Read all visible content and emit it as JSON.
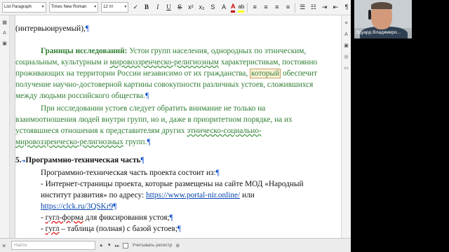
{
  "toolbar": {
    "style_value": "List Paragraph",
    "font_value": "Times New Roman",
    "size_value": "12 пт",
    "bold_icon": "B",
    "italic_icon": "I",
    "underline_icon": "U",
    "font_color_icon": "A",
    "highlight_icon": "ab"
  },
  "document": {
    "line1": "(интервьюируемый),",
    "line2_head": "Границы исследований:",
    "line2_rest": " Устои групп населения, однородных по этническим,",
    "line3_a": "социальным, культурным и ",
    "line3_sq": "мировоззренческо-религиозным",
    "line3_b": " характеристикам, постоянно",
    "line4_a": "проживающих на территории России независимо от их гражданства, ",
    "line4_box": "который",
    "line4_b": " обеспечит",
    "line5": "получение научно-достоверной картины совокупности различных устоев, сложившихся",
    "line6": "между людьми российского общества.",
    "line7": "При исследовании устоев следует обратить внимание не только на",
    "line8": "взаимоотношения людей внутри групп, но и, даже в приоритетном порядке, на их",
    "line9_a": "устоявшиеся отношения к представителям других ",
    "line9_sq": "этническо-социально-",
    "line10_sq": "мировоззренческо-религиозных",
    "line10_b": " групп.",
    "section_num": "5.",
    "section_title": "Программно-техническая часть",
    "p1": "Программно-техническая часть проекта состоит из:",
    "p2": "- Интернет-страницы проекта, которые размещены на сайте МОД «Народный",
    "p3_a": "институт развития» по адресу: ",
    "p3_link": "https://www.portal-nir.online/",
    "p3_b": " или",
    "p4_link": "https://clck.ru/3QSKr9",
    "p5_a": "- ",
    "p5_sq": "гугл-форма",
    "p5_b": " для фиксирования устоя;",
    "p6_a": " - ",
    "p6_sq": "гугл",
    "p6_b": " – таблица (полная) с базой устоев;"
  },
  "findbar": {
    "placeholder": "Найти",
    "match_case": "Учитывать регистр"
  },
  "webcam": {
    "participant_name": "Эдуард Владимиро..."
  }
}
